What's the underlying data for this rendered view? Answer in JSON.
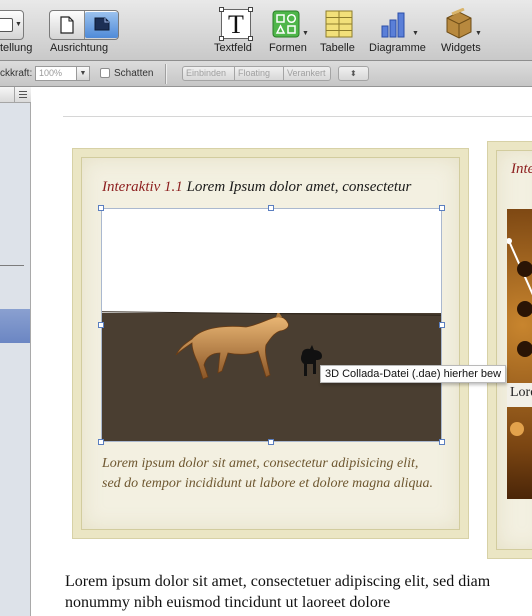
{
  "toolbar": {
    "items": [
      {
        "label": "tellung",
        "icon": "view-icon"
      },
      {
        "label": "Ausrichtung",
        "icon": "orientation-icon"
      },
      {
        "label": "Textfeld",
        "icon": "textbox-icon"
      },
      {
        "label": "Formen",
        "icon": "shapes-icon"
      },
      {
        "label": "Tabelle",
        "icon": "table-icon"
      },
      {
        "label": "Diagramme",
        "icon": "charts-icon"
      },
      {
        "label": "Widgets",
        "icon": "widgets-icon"
      }
    ],
    "textbox_glyph": "T"
  },
  "format_bar": {
    "opacity_label": "ckkraft:",
    "opacity_value": "100%",
    "shadow_label": "Schatten",
    "wrap_options": [
      "Einbinden",
      "Floating",
      "Verankert"
    ]
  },
  "document": {
    "card1": {
      "title_number": "Interaktiv 1.1",
      "title_text": "Lorem Ipsum dolor amet, consectetur",
      "caption": "Lorem ipsum dolor sit amet, consectetur adipisicing elit, sed do tempor incididunt ut labore et dolore magna aliqua."
    },
    "drop_tooltip": "3D Collada-Datei (.dae) hierher bew",
    "card2": {
      "title": "Inte",
      "strip_text": "Lore"
    },
    "body_paragraph": "Lorem ipsum dolor sit amet, consectetuer adipiscing elit, sed diam nonummy nibh euismod tincidunt ut laoreet dolore"
  },
  "colors": {
    "accent_blue": "#4f8ad8",
    "title_red": "#8d1f1f",
    "caption_brown": "#6e5730",
    "card_frame": "#ebe6c4",
    "ground": "#4a3e31"
  }
}
